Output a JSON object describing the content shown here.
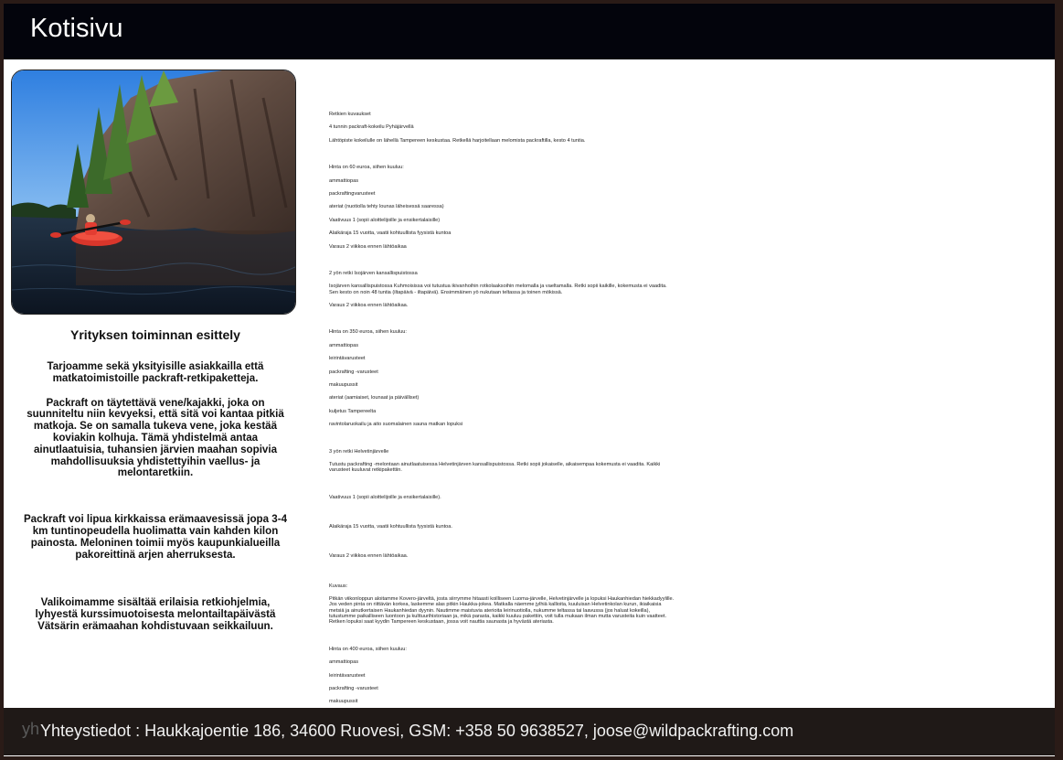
{
  "header": {
    "title": "Kotisivu"
  },
  "hero": {
    "alt": "packraft-kayaker-cliff-lake"
  },
  "intro": {
    "heading": "Yrityksen toiminnan esittely",
    "paragraphs": [
      "Tarjoamme sekä yksityisille asiakkailla että matkatoimistoille packraft-retkipaketteja.",
      "Packraft on täytettävä vene/kajakki, joka on suunniteltu niin kevyeksi, että sitä voi kantaa pitkiä matkoja. Se on samalla tukeva vene, joka kestää koviakin kolhuja. Tämä yhdistelmä antaa ainutlaatuisia, tuhansien järvien maahan sopivia mahdollisuuksia yhdistettyihin vaellus- ja melontaretkiin.",
      "Packraft voi lipua kirkkaissa erämaavesissä jopa 3-4 km tuntinopeudella huolimatta vain kahden kilon painosta. Meloninen toimii myös kaupunkialueilla pakoreittinä arjen aherruksesta.",
      "Valikoimamme sisältää erilaisia retkiohjelmia, lyhyestä kurssimuotoisesta melontailtapäivästä Vätsärin erämaahan kohdistuvaan seikkailuun."
    ]
  },
  "trips": {
    "heading": "Retkien kuvaukset",
    "trip1": {
      "title": "4 tunnin packraft-kokeilu Pyhäjärvellä",
      "desc": "Lähtöpiste kokeilulle on lähellä Tampereen keskustaa. Retkellä harjoitellaan melomista packraftilla, kesto 4 tuntia.",
      "price": "Hinta on 60 euroa, siihen kuuluu:",
      "items": [
        "ammattiopas",
        "packraftingvarusteet",
        "ateriat (nuotiolla tehty lounas läheisessä saaressa)",
        "Vaativuus 1 (sopii aloittelijoille ja ensikertalaisille)",
        "Alaikäraja 15 vuotta, vaatii kohtuullista fyysistä kuntoa",
        "Varaus 2 viikkoa ennen lähtöaikaa"
      ]
    },
    "trip2": {
      "title": "2 yön retki Isojärven kansallispuistossa",
      "desc": "Isojärven kansallispuistossa Kuhmoisissa voi tutustua ikivanhoihin rotkolaaksoihin melomalla ja vaeltamalla. Retki sopii kaikille, kokemusta ei vaadita. Sen kesto on noin 48 tuntia (iltapäivä - iltapäivä). Ensimmäinen yö nukutaan teltassa ja toinen mökissä.",
      "booking": "Varaus 2 viikkoa ennen lähtöaikaa.",
      "price": "Hinta on 350 euroa, siihen kuuluu:",
      "items": [
        "ammattiopas",
        "leirintävarusteet",
        "packrafting -varusteet",
        "makuupussit",
        "ateriat (aamiaiset, lounaat ja päivälliset)",
        "kuljetus Tampereelta",
        "ravintolaruokailu ja aito suomalainen sauna matkan lopuksi"
      ]
    },
    "trip3": {
      "title": "3 yön retki Helvetinjärvelle",
      "desc": "Tutustu packrafting -melontaan ainutlaatuisessa Helvetinjärven kansallispuistossa. Retki sopii jokaiselle, aikaisempaa kokemusta ei vaadita. Kaikki varusteet kuuluvat retkipakettiin.",
      "difficulty": "Vaativuus 1 (sopii aloittelijoille ja ensikertalaisille).",
      "age": "Alaikäraja 15 vuotta, vaatii kohtuullista fyysistä kuntoa.",
      "booking": "Varaus 2 viikkoa ennen lähtöaikaa.",
      "desc_label": "Kuvaus:",
      "long_desc": "Pitkän viikonloppun aloitamme Kovero-järveltä, josta siirrymme hitaasti koilliseen Luoma-järvelle, Helvetinjärvelle ja lopuksi Haukanhiedan hiekkadyylille. Jos veden pinta on riittävän korkea, laskemme alas pitkin Haukka-jokea. Matkalla näemme jylhiä kallioita, kuuluisan Helvetinkolan kurun, ikiaikaisia metsiä ja ainutkertaisen Haukanhiedan dyynin. Nautimme maistuvia aterioita leirinuotiolla, nukumme teltassa tai laavussa (jos haluat kokeilla), tutustumme paikalliseen luontoon ja kulttuurihistoriaan ja, mikä parasta, kaikki kuuluu pakettiin, voit tulla mukaan ilman mutta varusteita kuin vaatteet. Retken lopuksi saat kyydin Tampereen keskustaan, jossa voit nauttia saunasta ja hyvästä ateriasta.",
      "price": "Hinta on 400 euroa, siihen kuuluu:",
      "items": [
        "ammattiopas",
        "leirintävarusteet",
        "packrafting -varusteet",
        "makuupussit"
      ]
    }
  },
  "footer": {
    "ghost": "yh",
    "contact": "Yhteystiedot :  Haukkajoentie 186, 34600 Ruovesi, GSM: +358 50 9638527, joose@wildpackrafting.com"
  }
}
